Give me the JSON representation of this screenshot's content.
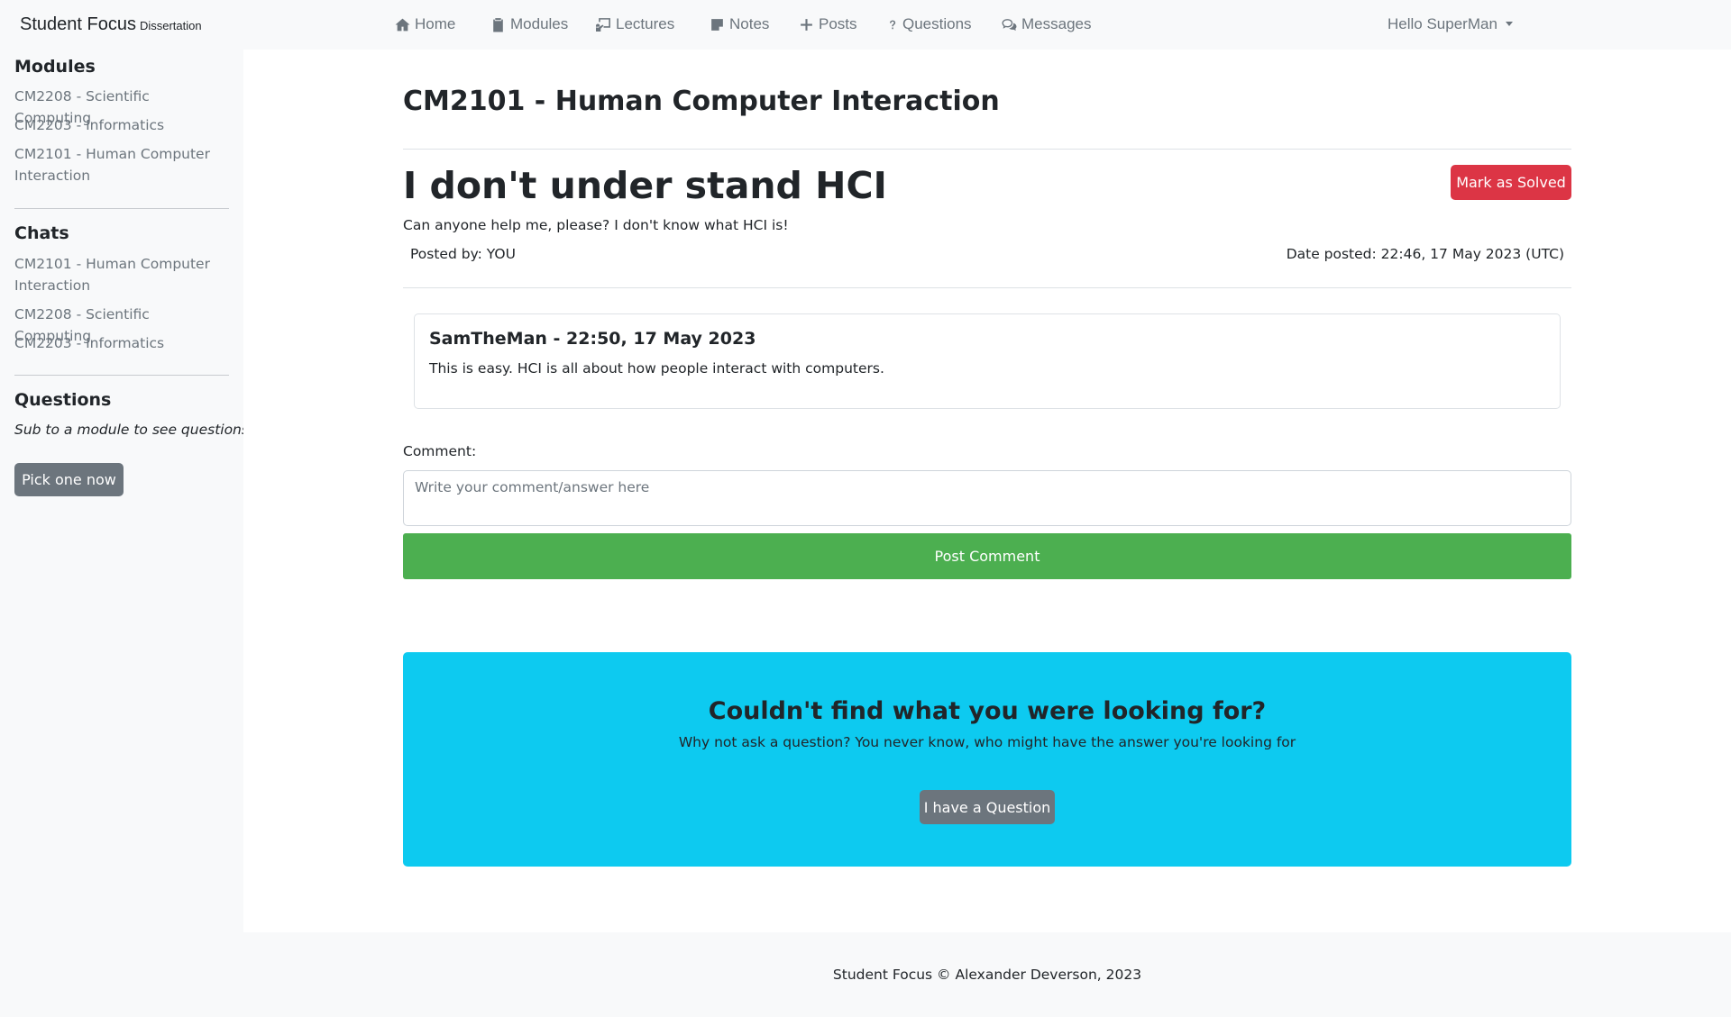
{
  "navbar": {
    "brand": "Student Focus",
    "brand_sub": "Dissertation",
    "items": [
      {
        "label": "Home",
        "icon": "home-icon"
      },
      {
        "label": "Modules",
        "icon": "clipboard-icon"
      },
      {
        "label": "Lectures",
        "icon": "lecture-icon"
      },
      {
        "label": "Notes",
        "icon": "note-icon"
      },
      {
        "label": "Posts",
        "icon": "plus-icon"
      },
      {
        "label": "Questions",
        "icon": "question-icon"
      },
      {
        "label": "Messages",
        "icon": "chat-icon"
      }
    ],
    "user_greeting": "Hello SuperMan"
  },
  "sidebar": {
    "modules_heading": "Modules",
    "modules": [
      "CM2208 - Scientific Computing",
      "CM2203 - Informatics",
      "CM2101 - Human Computer Interaction"
    ],
    "chats_heading": "Chats",
    "chats": [
      "CM2101 - Human Computer Interaction",
      "CM2208 - Scientific Computing",
      "CM2203 - Informatics"
    ],
    "questions_heading": "Questions",
    "questions_note": "Sub to a module to see questions",
    "pick_button": "Pick one now"
  },
  "main": {
    "module_title": "CM2101 - Human Computer Interaction",
    "question": {
      "title": "I don't under stand HCI",
      "body": "Can anyone help me, please? I don't know what HCI is!",
      "posted_by": "Posted by: YOU",
      "date_posted": "Date posted: 22:46, 17 May 2023 (UTC)",
      "solve_button": "Mark as Solved"
    },
    "comments": [
      {
        "header": "SamTheMan - 22:50, 17 May 2023",
        "text": "This is easy. HCI is all about how people interact with computers."
      }
    ],
    "comment_form": {
      "label": "Comment:",
      "placeholder": "Write your comment/answer here",
      "value": "",
      "submit": "Post Comment"
    },
    "cta": {
      "heading": "Couldn't find what you were looking for?",
      "text": "Why not ask a question? You never know, who might have the answer you're looking for",
      "button": "I have a Question"
    }
  },
  "footer": {
    "text": "Student Focus © Alexander Deverson, 2023"
  },
  "colors": {
    "danger": "#dc3545",
    "success": "#4caf50",
    "info": "#0dcaf0",
    "secondary": "#6c757d"
  }
}
